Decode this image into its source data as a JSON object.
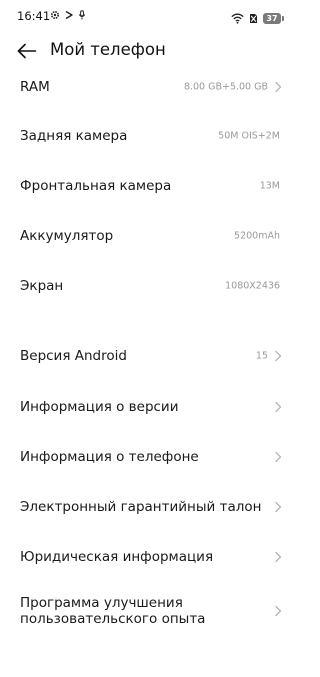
{
  "status_bar": {
    "time": "16:41",
    "battery_level": "37",
    "left_icons": [
      "gear-icon",
      "play-arrow-icon",
      "microphone-icon"
    ],
    "right_icons": [
      "wifi-icon",
      "sim-off-icon",
      "battery-icon"
    ]
  },
  "header": {
    "title": "Мой телефон"
  },
  "specs": [
    {
      "label": "RAM",
      "value": "8.00 GB+5.00 GB"
    },
    {
      "label": "Задняя камера",
      "value": "50M OIS+2M"
    },
    {
      "label": "Фронтальная камера",
      "value": "13M"
    },
    {
      "label": "Аккумулятор",
      "value": "5200mAh"
    },
    {
      "label": "Экран",
      "value": "1080X2436"
    }
  ],
  "menu": [
    {
      "label": "Версия Android",
      "value": "15"
    },
    {
      "label": "Информация о версии"
    },
    {
      "label": "Информация о телефоне"
    },
    {
      "label": "Электронный гарантийный талон"
    },
    {
      "label": "Юридическая информация"
    },
    {
      "label": "Программа улучшения пользовательского опыта"
    }
  ],
  "colors": {
    "text": "#1a1a1a",
    "secondary_text": "#9a9a9a",
    "chevron": "#b5b5b5",
    "background": "#ffffff"
  }
}
